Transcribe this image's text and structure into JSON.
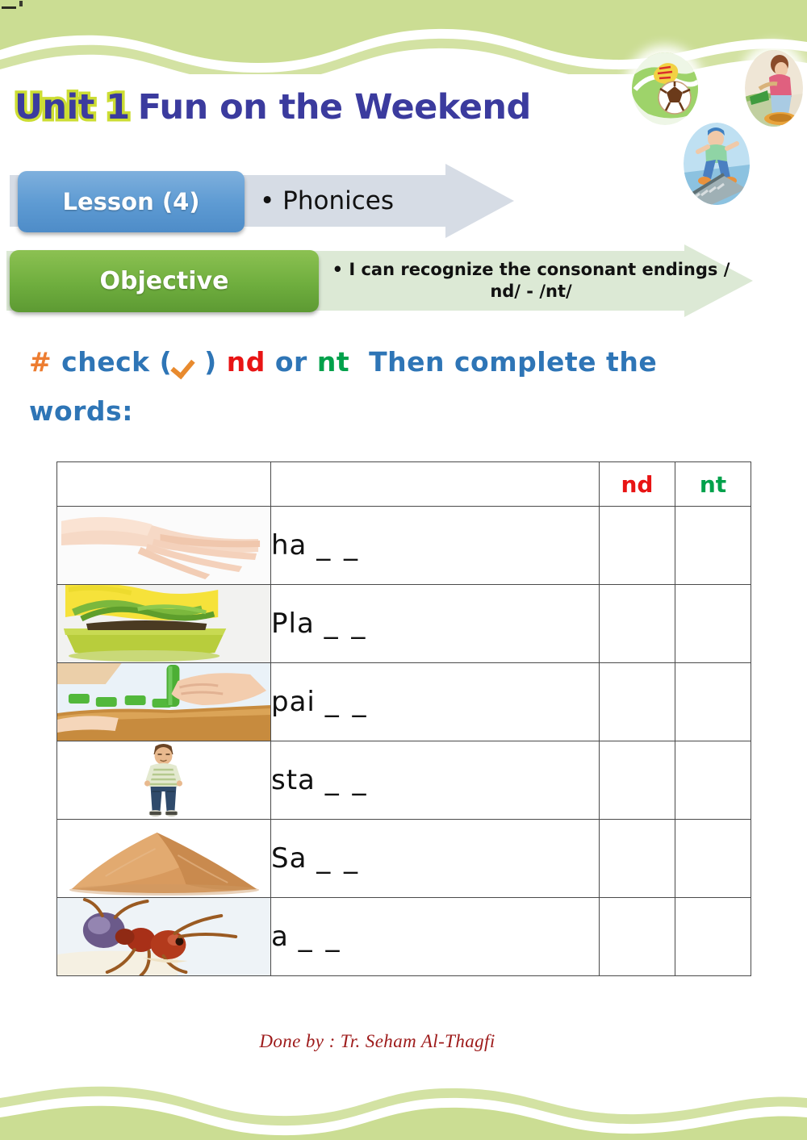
{
  "page": {
    "unit_badge": "Unit 1",
    "unit_title": "Fun on the Weekend",
    "credit": "Done by : Tr. Seham Al-Thagfi"
  },
  "lesson_bar": {
    "chip_label": "Lesson (4)",
    "text": "• Phonices"
  },
  "objective_bar": {
    "chip_label": "Objective",
    "text": "• I can recognize the consonant endings / nd/  - /nt/"
  },
  "instruction": {
    "hash": "#",
    "part1": "check (",
    "tick_icon": "check-mark-icon",
    "part2": ")",
    "nd": "nd",
    "or": "or",
    "nt": "nt",
    "part3": "Then complete the",
    "line2": "words:"
  },
  "table": {
    "headers": [
      "",
      "",
      "nd",
      "nt"
    ],
    "rows": [
      {
        "image": "hand-photo",
        "word": "ha",
        "blanks": "_ _",
        "nd_checked": false,
        "nt_checked": false
      },
      {
        "image": "potted-plant-photo",
        "word": "Pla",
        "blanks": "_ _",
        "nd_checked": false,
        "nt_checked": false
      },
      {
        "image": "painting-hand-photo",
        "word": "pai",
        "blanks": "_ _",
        "nd_checked": false,
        "nt_checked": false
      },
      {
        "image": "standing-boy-photo",
        "word": "sta",
        "blanks": "_ _",
        "nd_checked": false,
        "nt_checked": false
      },
      {
        "image": "sand-pile-photo",
        "word": "Sa",
        "blanks": "_ _",
        "nd_checked": false,
        "nt_checked": false
      },
      {
        "image": "ant-photo",
        "word": "a",
        "blanks": "_ _",
        "nd_checked": false,
        "nt_checked": false
      }
    ]
  },
  "decor": {
    "border_color": "#cbdd93",
    "ovals": [
      "soccer-ball-clipart",
      "skating-person-clipart",
      "jumping-boy-clipart"
    ]
  },
  "colors": {
    "unit_text": "#3b3b9e",
    "unit_outline": "#ccdd33",
    "lesson_chip": "#5e9bd3",
    "objective_chip": "#6fae3e",
    "nd_red": "#e81414",
    "nt_green": "#00a14b",
    "hash_orange": "#ed7d31",
    "instruction_blue": "#2e75b6",
    "credit_red": "#9e1b1b"
  }
}
